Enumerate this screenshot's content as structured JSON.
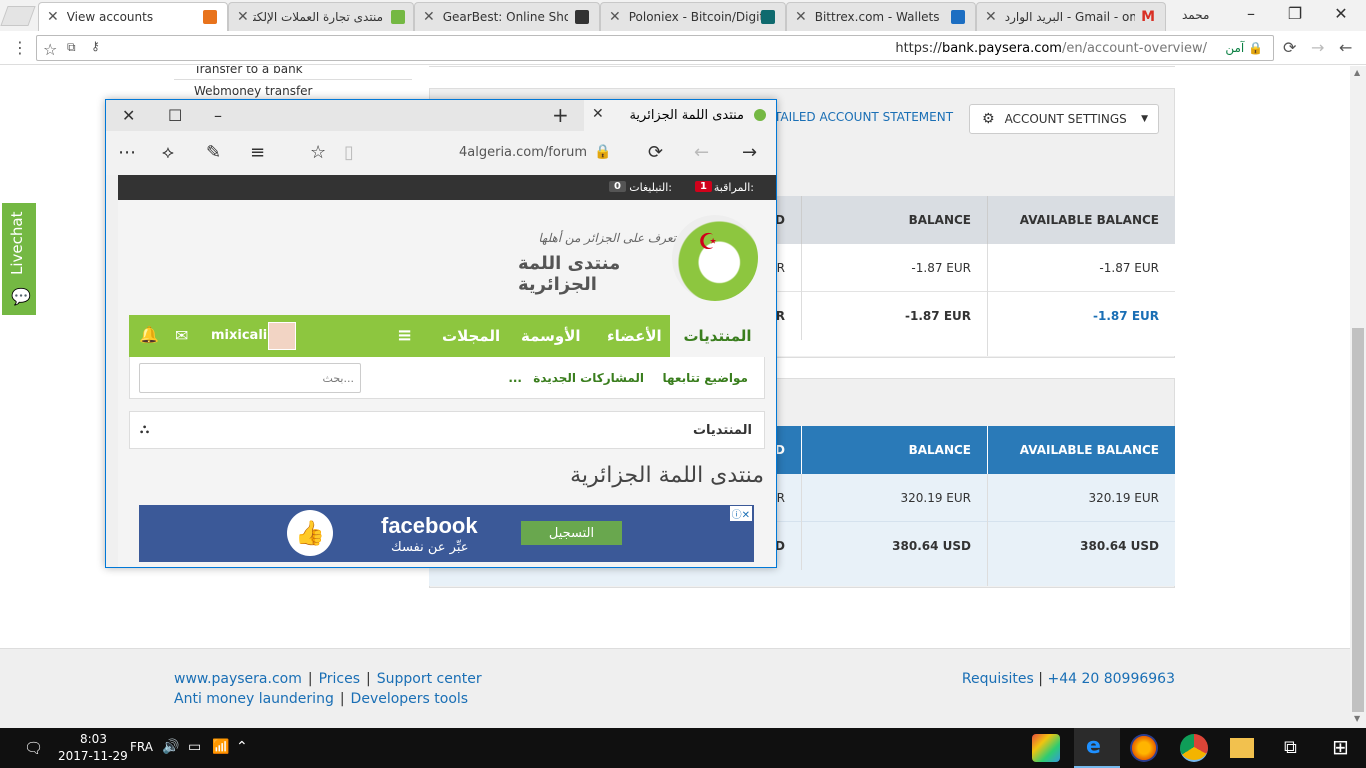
{
  "chrome": {
    "tabs": [
      {
        "label": "View accounts",
        "active": true
      },
      {
        "label": "منتدى تجارة العملات الإلكترونية",
        "active": false
      },
      {
        "label": "GearBest: Online Shopping",
        "active": false
      },
      {
        "label": "Poloniex - Bitcoin/Digital",
        "active": false
      },
      {
        "label": "Bittrex.com - Wallets",
        "active": false
      },
      {
        "label": "البريد الوارد - Gmail - om",
        "active": false
      }
    ],
    "profile": "محمد",
    "url_scheme": "https://",
    "url_host": "bank.paysera.com",
    "url_path": "/en/account-overview/",
    "secure_label": "آمن"
  },
  "paysera": {
    "sidebar": [
      "Transfer to a bank",
      "Webmoney transfer"
    ],
    "detail_link": "TAILED ACCOUNT STATEMENT",
    "account_settings": "ACCOUNT SETTINGS",
    "table1": {
      "headers": [
        "ED",
        "BALANCE",
        "AVAILABLE BALANCE"
      ],
      "rows": [
        [
          "R",
          "-1.87 EUR",
          "-1.87 EUR"
        ],
        [
          "R",
          "-1.87 EUR",
          "-1.87 EUR"
        ]
      ]
    },
    "table2": {
      "headers": [
        "ED",
        "BALANCE",
        "AVAILABLE BALANCE"
      ],
      "rows": [
        [
          "R",
          "320.19 EUR",
          "320.19 EUR"
        ],
        [
          "D",
          "380.64 USD",
          "380.64 USD"
        ]
      ]
    },
    "footer": {
      "links1": [
        "www.paysera.com",
        "Prices",
        "Support center"
      ],
      "links2": [
        "Anti money laundering",
        "Developers tools"
      ],
      "requisites": "Requisites",
      "phone": "+44 20 80996963"
    },
    "livechat": "Livechat"
  },
  "edge": {
    "tab_title": "منتدى اللمة الجزائرية",
    "url": "4algeria.com/forum",
    "forum": {
      "watch_label": "المراقبة:",
      "watch_count": "1",
      "alerts_label": "التبليغات:",
      "alerts_count": "0",
      "logo_text": "منتدى اللمة الجزائرية",
      "logo_slogan": "تعرف على الجزائر من أهلها",
      "nav": [
        "المنتديات",
        "الأعضاء",
        "الأوسمة",
        "المجلات"
      ],
      "username": "mixicali",
      "sub": [
        "مواضيع تتابعها",
        "المشاركات الجديدة",
        "..."
      ],
      "search_placeholder": "بحث...",
      "breadcrumb": "المنتديات",
      "heading": "منتدى اللمة الجزائرية",
      "ad_brand": "facebook",
      "ad_slogan": "عبِّر عن نفسك",
      "ad_button": "التسجيل"
    }
  },
  "taskbar": {
    "time": "8:03",
    "date": "2017-11-29",
    "lang": "FRA"
  }
}
